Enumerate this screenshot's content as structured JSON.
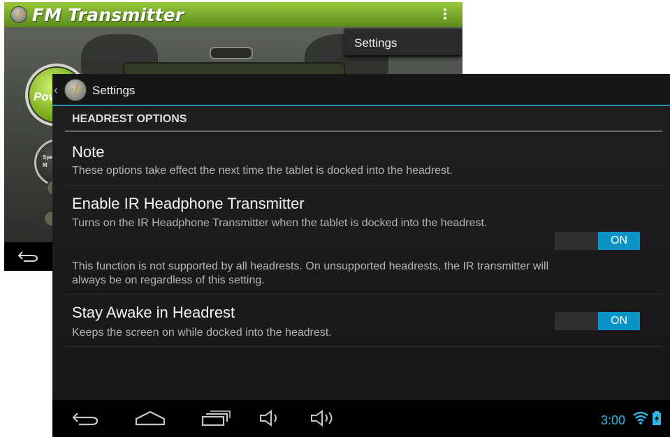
{
  "background_app": {
    "title": "FM Transmitter",
    "logo_glyph": "·/·",
    "overflow_menu_item": "Settings",
    "power_label": "Power",
    "speaker_label": "Spe\nM",
    "accent_color": "#8bbf2f"
  },
  "settings": {
    "up_glyph": "‹",
    "logo_glyph": "·/·",
    "title": "Settings",
    "section_header": "HEADREST OPTIONS",
    "accent_color": "#0a93c6",
    "items": [
      {
        "title": "Note",
        "summary": "These options take effect the next time the tablet is docked into the headrest."
      },
      {
        "title": "Enable IR Headphone Transmitter",
        "summary": "Turns on the IR Headphone Transmitter when the tablet is docked into the headrest.",
        "extra_summary": "This function is not supported by all headrests. On unsupported headrests, the IR transmitter will always be on regardless of this setting.",
        "switch_label": "ON",
        "switch_on": true
      },
      {
        "title": "Stay Awake in Headrest",
        "summary": "Keeps the screen on while docked into the headrest.",
        "switch_label": "ON",
        "switch_on": true
      }
    ]
  },
  "status_bar": {
    "time": "3:00",
    "time_color": "#34b5e5",
    "icons": [
      "wifi-icon",
      "battery-charging-icon"
    ]
  },
  "nav_bar": {
    "icons": [
      "back-icon",
      "home-icon",
      "recent-apps-icon",
      "volume-down-icon",
      "volume-up-icon"
    ]
  }
}
